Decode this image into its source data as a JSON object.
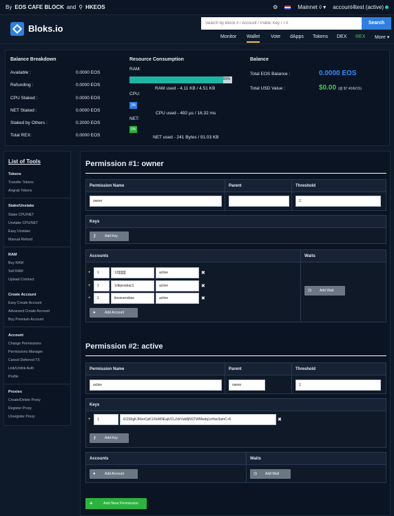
{
  "topbar": {
    "by": "By",
    "block": "EOS CAFE BLOCK",
    "and": "and",
    "partner": "HKEOS",
    "network": "Mainnet",
    "account": "account4test (active)"
  },
  "header": {
    "brand": "Bloks.io",
    "search_placeholder": "Search by Block # / Account / Public Key / TX",
    "search_button": "Search",
    "nav": [
      "Monitor",
      "Wallet",
      "Vote",
      "dApps",
      "Tokens",
      "DEX",
      "REX",
      "More"
    ],
    "nav_active": "Wallet"
  },
  "balance_breakdown": {
    "title": "Balance Breakdown",
    "rows": [
      {
        "label": "Available :",
        "value": "0.0000 EOS"
      },
      {
        "label": "Refunding :",
        "value": "0.0000 EOS"
      },
      {
        "label": "CPU Staked :",
        "value": "0.0000 EOS"
      },
      {
        "label": "NET Staked :",
        "value": "0.0000 EOS"
      },
      {
        "label": "Staked by Others :",
        "value": "0.2000 EOS"
      },
      {
        "label": "Total REX:",
        "value": "0.0000 EOS"
      }
    ]
  },
  "resources": {
    "title": "Resource Consumption",
    "ram_label": "RAM:",
    "ram_percent": 91,
    "ram_percent_text": "91%",
    "ram_used": "RAM used - 4.11 KB / 4.51 KB",
    "cpu_label": "CPU:",
    "cpu_percent_text": "3%",
    "cpu_used": "CPU used - 492 µs / 16.32 ms",
    "net_label": "NET:",
    "net_percent_text": "0%",
    "net_used": "NET used - 241 Bytes / 91.03 KB"
  },
  "balance": {
    "title": "Balance",
    "eos_label": "Total EOS Balance :",
    "eos_value": "0.0000 EOS",
    "usd_label": "Total USD Value :",
    "usd_value": "$0.00",
    "usd_rate": "(@ $7.40/EOS)"
  },
  "sidebar": {
    "title": "List of Tools",
    "sections": [
      {
        "name": "Tokens",
        "items": [
          "Transfer Tokens",
          "Airgrab Tokens"
        ]
      },
      {
        "name": "Stake/Unstake",
        "items": [
          "Stake CPU/NET",
          "Unstake CPU/NET",
          "Easy Unstake",
          "Manual Refund"
        ]
      },
      {
        "name": "RAM",
        "items": [
          "Buy RAM",
          "Sell RAM",
          "Upload Contract"
        ]
      },
      {
        "name": "Create Account",
        "items": [
          "Easy Create Account",
          "Advanced Create Account",
          "Buy Premium Account"
        ]
      },
      {
        "name": "Account",
        "items": [
          "Change Permissions",
          "Permissions Manager",
          "Cancel Deferred TX",
          "Link/Unlink Auth",
          "Profile"
        ]
      },
      {
        "name": "Proxies",
        "items": [
          "Create/Delete Proxy",
          "Register Proxy",
          "Unregister Proxy"
        ]
      }
    ]
  },
  "permissions": {
    "headers": {
      "name": "Permission Name",
      "parent": "Parent",
      "threshold": "Threshold",
      "keys": "Keys",
      "accounts": "Accounts",
      "waits": "Waits"
    },
    "buttons": {
      "add_key": "Add Key",
      "add_account": "Add Account",
      "add_wait": "Add Wait",
      "add_permission": "Add New Permission"
    },
    "owner": {
      "title": "Permission #1: owner",
      "name": "owner",
      "parent": "",
      "threshold": "2",
      "accounts": [
        {
          "weight": "1",
          "account": "12[[[[[[[[",
          "permission": "active"
        },
        {
          "weight": "1",
          "account": "1rtkjeosbac1",
          "permission": "active"
        },
        {
          "weight": "1",
          "account": "iloveueosbac",
          "permission": "active"
        }
      ]
    },
    "active": {
      "title": "Permission #2: active",
      "name": "active",
      "parent": "owner",
      "threshold": "1",
      "keys": [
        {
          "weight": "1",
          "key": "EOS5gKJKboCpK1XtoM3EajUCLZdrVub8jNSTWMwdq1sHav3amC+5"
        }
      ]
    }
  }
}
